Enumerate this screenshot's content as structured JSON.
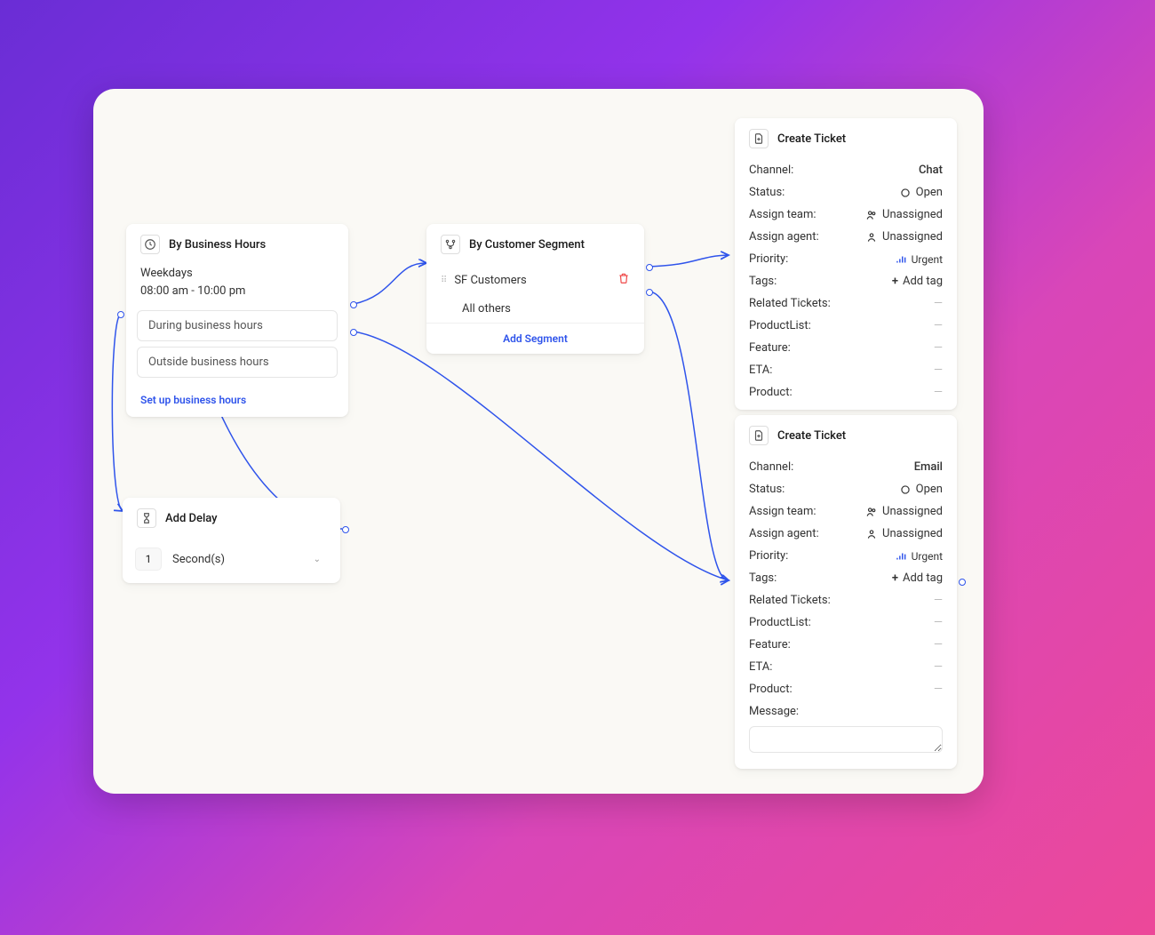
{
  "businessHours": {
    "title": "By Business Hours",
    "days": "Weekdays",
    "time": "08:00 am - 10:00 pm",
    "during": "During business hours",
    "outside": "Outside business hours",
    "setup": "Set up business hours"
  },
  "segment": {
    "title": "By Customer Segment",
    "item1": "SF Customers",
    "allOthers": "All others",
    "add": "Add Segment"
  },
  "delay": {
    "title": "Add Delay",
    "value": "1",
    "unit": "Second(s)"
  },
  "ticket1": {
    "title": "Create Ticket",
    "channel_l": "Channel:",
    "channel_v": "Chat",
    "status_l": "Status:",
    "status_v": "Open",
    "team_l": "Assign team:",
    "team_v": "Unassigned",
    "agent_l": "Assign agent:",
    "agent_v": "Unassigned",
    "priority_l": "Priority:",
    "priority_v": "Urgent",
    "tags_l": "Tags:",
    "tags_v": "Add tag",
    "related_l": "Related Tickets:",
    "plist_l": "ProductList:",
    "feature_l": "Feature:",
    "eta_l": "ETA:",
    "product_l": "Product:",
    "dash": "—"
  },
  "ticket2": {
    "title": "Create Ticket",
    "channel_l": "Channel:",
    "channel_v": "Email",
    "status_l": "Status:",
    "status_v": "Open",
    "team_l": "Assign team:",
    "team_v": "Unassigned",
    "agent_l": "Assign agent:",
    "agent_v": "Unassigned",
    "priority_l": "Priority:",
    "priority_v": "Urgent",
    "tags_l": "Tags:",
    "tags_v": "Add tag",
    "related_l": "Related Tickets:",
    "plist_l": "ProductList:",
    "feature_l": "Feature:",
    "eta_l": "ETA:",
    "product_l": "Product:",
    "message_l": "Message:",
    "dash": "—"
  }
}
